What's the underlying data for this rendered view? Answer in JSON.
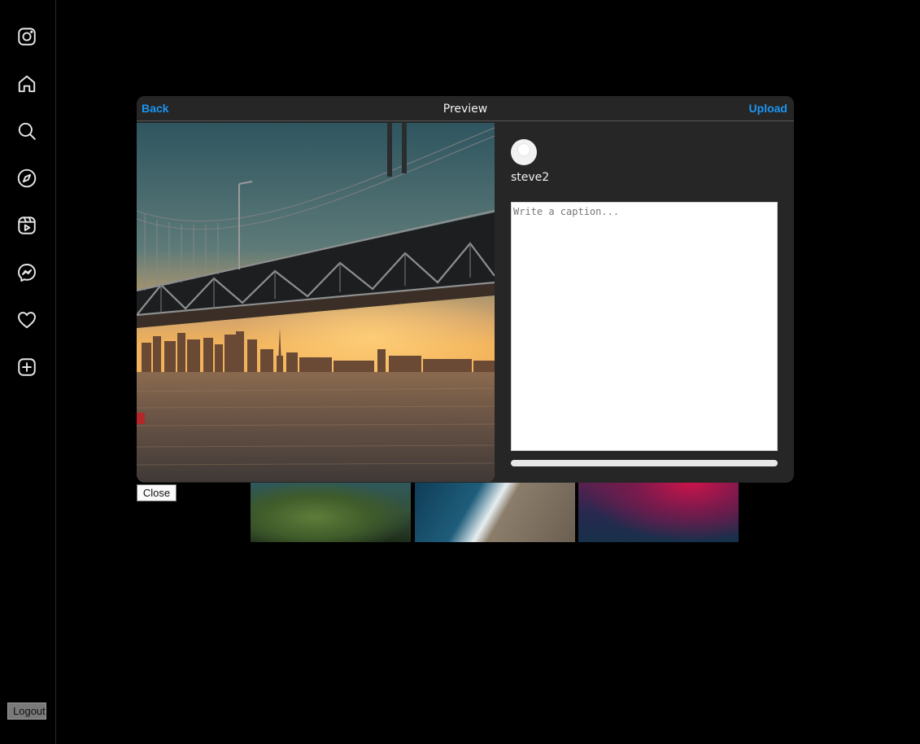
{
  "sidebar": {
    "items": [
      {
        "icon": "instagram-icon"
      },
      {
        "icon": "home-icon"
      },
      {
        "icon": "search-icon"
      },
      {
        "icon": "explore-icon"
      },
      {
        "icon": "reels-icon"
      },
      {
        "icon": "messenger-icon"
      },
      {
        "icon": "heart-icon"
      },
      {
        "icon": "create-icon"
      }
    ],
    "logout_label": "Logout"
  },
  "modal": {
    "back_label": "Back",
    "title": "Preview",
    "upload_label": "Upload",
    "username": "steve2",
    "caption": {
      "value": "",
      "placeholder": "Write a caption..."
    },
    "upload_progress": 0
  },
  "close_label": "Close",
  "colors": {
    "accent": "#1a95f2",
    "modal_bg": "#262626",
    "page_bg": "#000000"
  }
}
